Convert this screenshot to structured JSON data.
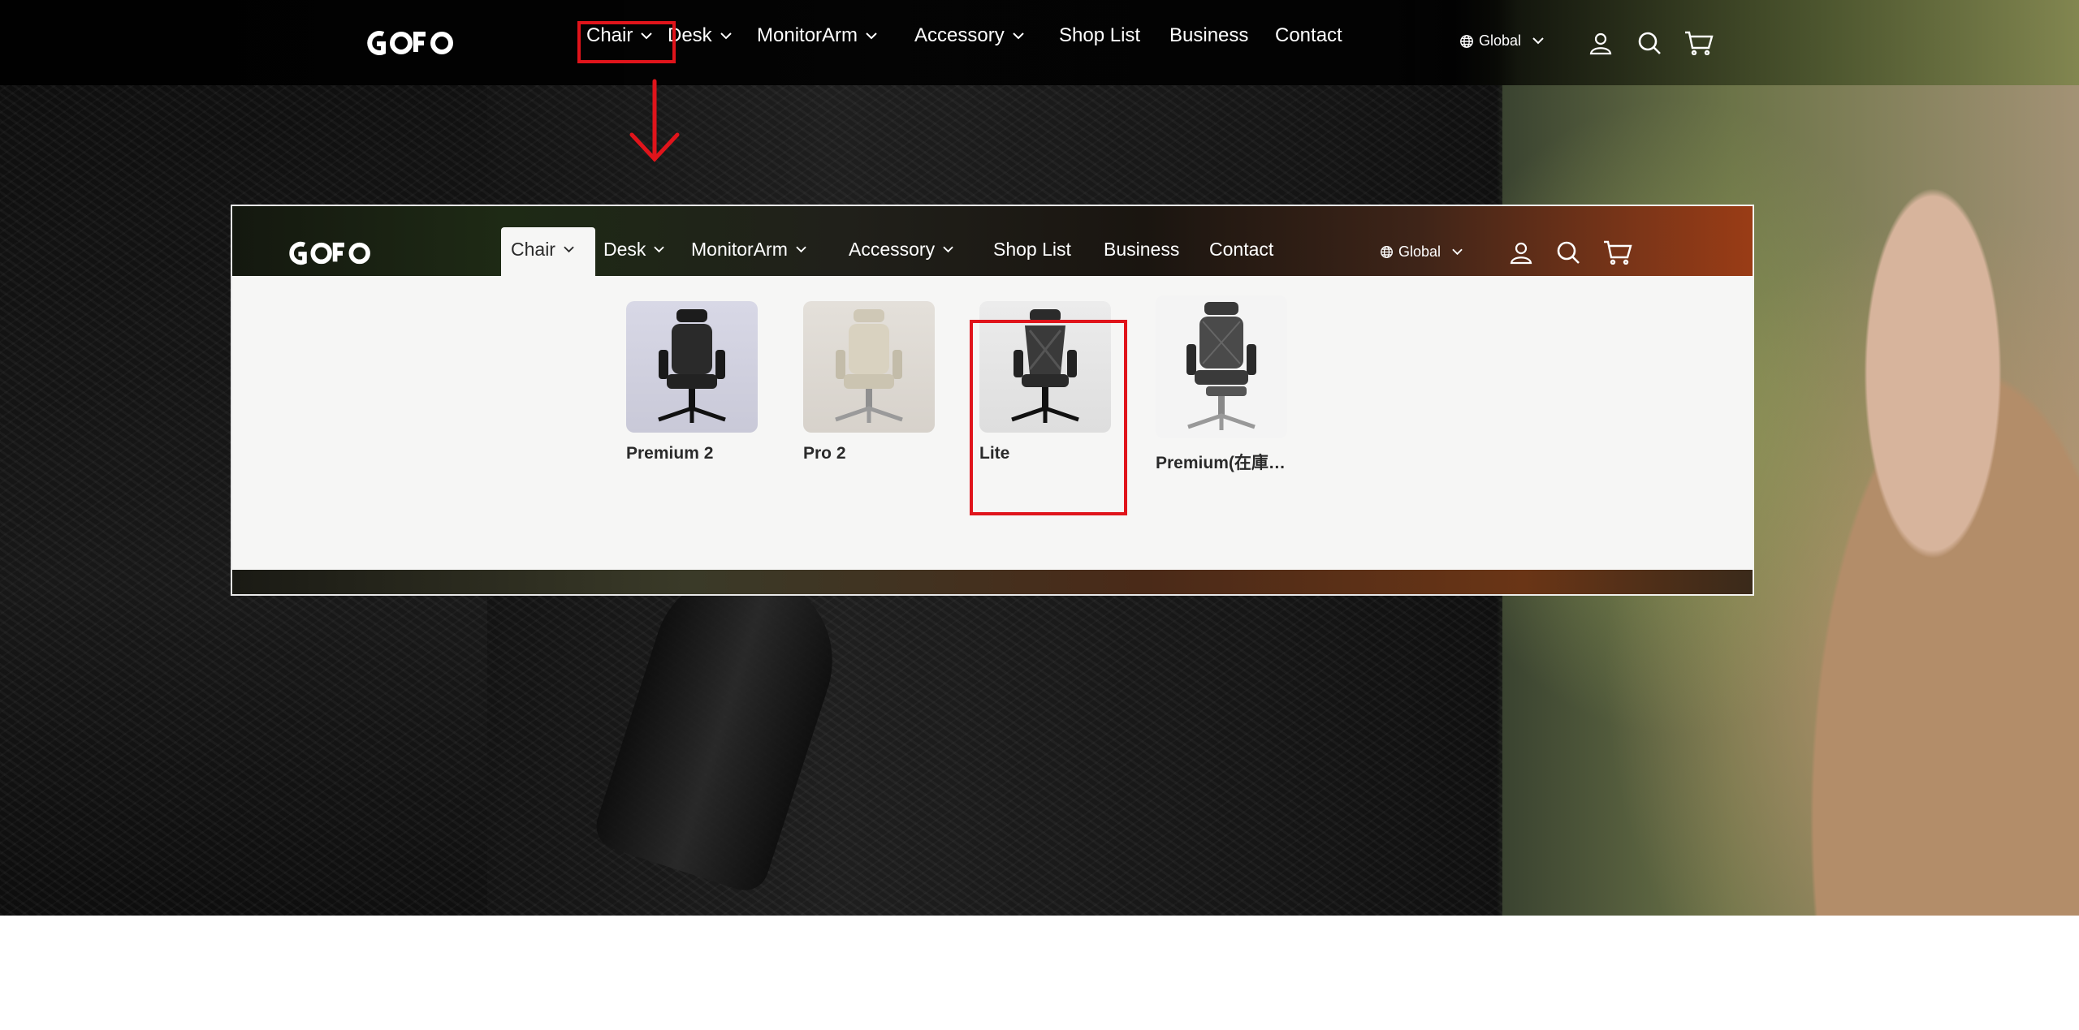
{
  "brand": {
    "logo_text": "GOFO"
  },
  "nav": {
    "items": [
      {
        "label": "Chair",
        "has_dropdown": true
      },
      {
        "label": "Desk",
        "has_dropdown": true
      },
      {
        "label": "MonitorArm",
        "has_dropdown": true
      },
      {
        "label": "Accessory",
        "has_dropdown": true
      },
      {
        "label": "Shop List",
        "has_dropdown": false
      },
      {
        "label": "Business",
        "has_dropdown": false
      },
      {
        "label": "Contact",
        "has_dropdown": false
      }
    ]
  },
  "region": {
    "label": "Global",
    "icon": "globe-icon"
  },
  "utility_icons": [
    "account-icon",
    "search-icon",
    "cart-icon"
  ],
  "dropdown": {
    "products": [
      {
        "name": "Premium 2",
        "variant": "dark-mesh-chair"
      },
      {
        "name": "Pro 2",
        "variant": "beige-chair"
      },
      {
        "name": "Lite",
        "variant": "dark-chair"
      },
      {
        "name": "Premium(在庫…",
        "variant": "footrest-chair"
      }
    ]
  },
  "annotations": {
    "highlight_color": "#e0141b"
  },
  "colors": {
    "header_text": "#ffffff",
    "dropdown_bg": "#f6f6f5",
    "product_text": "#2a2a2a"
  }
}
